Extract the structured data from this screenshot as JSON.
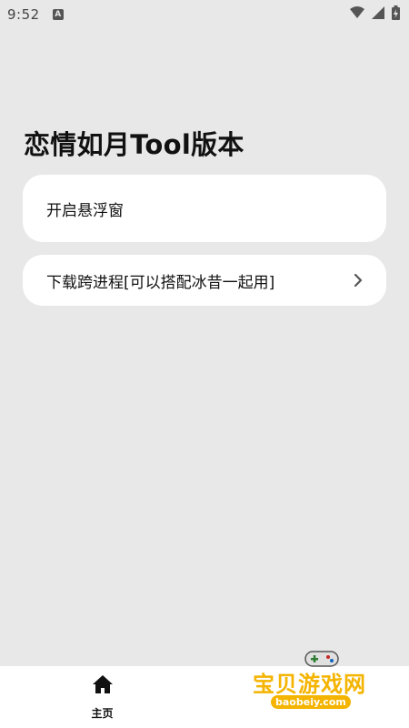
{
  "status_bar": {
    "time": "9:52",
    "notification_icon": "a-notification-icon",
    "wifi_icon": "wifi-icon",
    "signal_icon": "signal-icon",
    "battery_icon": "battery-charging-icon"
  },
  "page": {
    "title": "恋情如月Tool版本"
  },
  "cards": [
    {
      "label": "开启悬浮窗"
    },
    {
      "label": "下载跨进程[可以搭配冰昔一起用]",
      "icon": "chevron-right-icon"
    }
  ],
  "bottom_nav": {
    "items": [
      {
        "label": "主页",
        "icon": "home-icon"
      }
    ]
  },
  "watermark": {
    "text": "宝贝游戏网",
    "url": "baobeiy.com"
  },
  "colors": {
    "background": "#e8e8e8",
    "card": "#ffffff",
    "watermark": "#f4b400"
  }
}
